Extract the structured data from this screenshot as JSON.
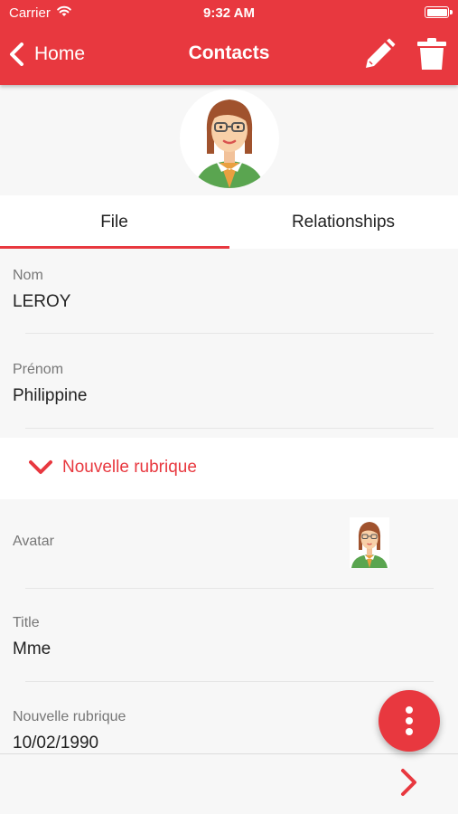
{
  "status_bar": {
    "carrier": "Carrier",
    "time": "9:32 AM"
  },
  "nav": {
    "back_label": "Home",
    "title": "Contacts",
    "edit_icon": "pencil-icon",
    "delete_icon": "trash-icon"
  },
  "tabs": [
    {
      "label": "File",
      "active": true
    },
    {
      "label": "Relationships",
      "active": false
    }
  ],
  "fields": {
    "nom": {
      "label": "Nom",
      "value": "LEROY"
    },
    "prenom": {
      "label": "Prénom",
      "value": "Philippine"
    },
    "avatar": {
      "label": "Avatar"
    },
    "title": {
      "label": "Title",
      "value": "Mme"
    },
    "nouvelle_rubrique": {
      "label": "Nouvelle rubrique",
      "value": "10/02/1990"
    }
  },
  "section": {
    "label": "Nouvelle rubrique",
    "icon": "chevron-down-icon"
  },
  "fab_icon": "more-vertical-icon",
  "bottom_nav_icon": "chevron-right-icon",
  "colors": {
    "accent": "#e8383f",
    "background": "#f7f7f7",
    "label": "#777777"
  }
}
